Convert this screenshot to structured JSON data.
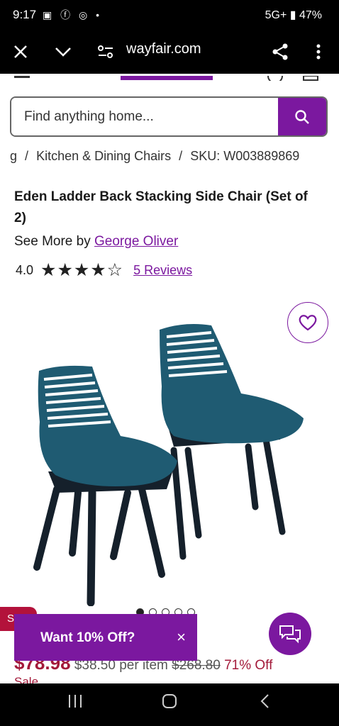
{
  "status": {
    "time": "9:17",
    "icons": "▣ ⓕ ◎ •",
    "right": "5G+ ▮ 47%"
  },
  "browser": {
    "url": "wayfair.com"
  },
  "search": {
    "placeholder": "Find anything home..."
  },
  "breadcrumb": {
    "items": [
      "g",
      "/",
      "Kitchen & Dining Chairs",
      "/",
      "SKU: W003889869"
    ]
  },
  "product": {
    "title": "Eden Ladder Back Stacking Side Chair (Set of 2)",
    "see_more_prefix": "See More by",
    "brand": "George Oliver",
    "rating": "4.0",
    "stars": "★★★★☆",
    "reviews": "5 Reviews"
  },
  "carousel": {
    "dots": 5,
    "active": 0
  },
  "price": {
    "current": "$78.98",
    "per_item": "$38.50 per item",
    "original": "$268.80",
    "discount": "71% Off",
    "sale_label": "Sale"
  },
  "sale_badge": "S",
  "promo": {
    "text": "Want 10% Off?",
    "close": "×"
  },
  "colors": {
    "brand_purple": "#7b189f",
    "sale_red": "#a31a3a",
    "chair_teal": "#1f5b72",
    "chair_legs": "#15202b"
  }
}
